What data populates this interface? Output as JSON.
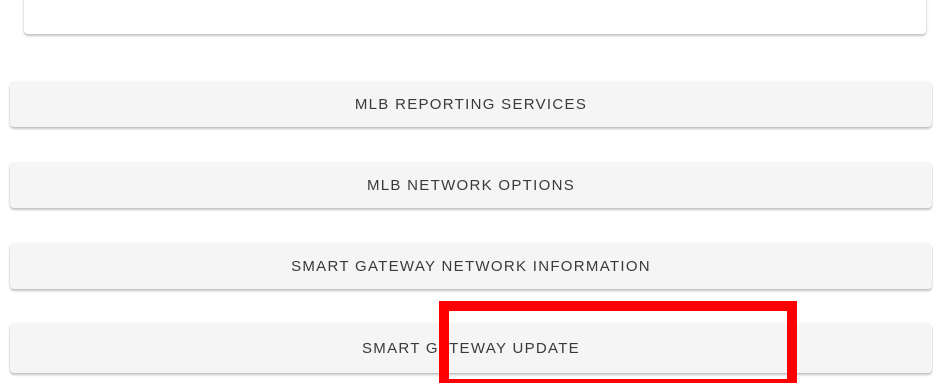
{
  "menu": {
    "items": [
      {
        "label": "MLB REPORTING SERVICES"
      },
      {
        "label": "MLB NETWORK OPTIONS"
      },
      {
        "label": "SMART GATEWAY NETWORK INFORMATION"
      },
      {
        "label": "SMART GATEWAY UPDATE"
      }
    ]
  },
  "annotation": {
    "highlight_color": "#ff0000"
  },
  "colors": {
    "button_background": "#f5f5f5",
    "button_text": "#3a3a3a"
  }
}
